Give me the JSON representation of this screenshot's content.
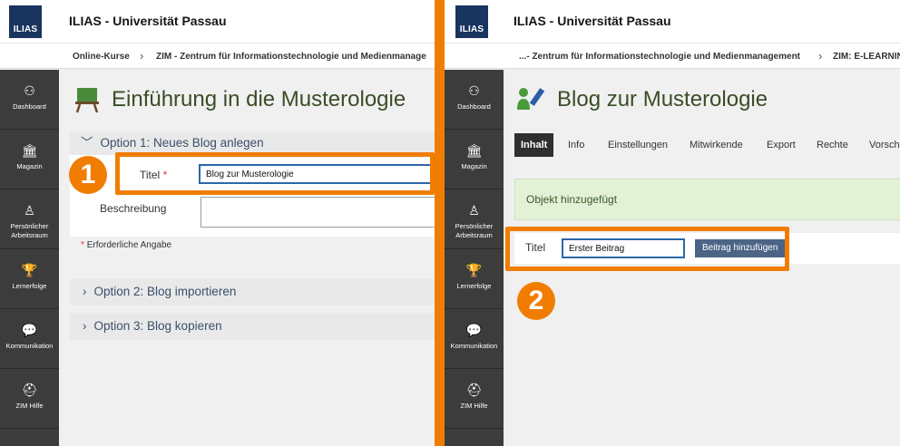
{
  "header": {
    "logo_text": "ILIAS",
    "site_title": "ILIAS - Universität Passau"
  },
  "left": {
    "breadcrumb": [
      "Online-Kurse",
      "ZIM - Zentrum für Informationstechnologie und Medienmanage"
    ],
    "page_title": "Einführung in die Musterologie",
    "option1_label": "Option 1: Neues Blog anlegen",
    "title_label": "Titel",
    "title_value": "Blog zur Musterologie",
    "description_label": "Beschreibung",
    "required_note": "Erforderliche Angabe",
    "option2_label": "Option 2: Blog importieren",
    "option3_label": "Option 3: Blog kopieren",
    "badge": "1"
  },
  "right": {
    "breadcrumb": [
      "...- Zentrum für Informationstechnologie und Medienmanagement",
      "ZIM: E-LEARNIN"
    ],
    "page_title": "Blog zur Musterologie",
    "tabs": [
      "Inhalt",
      "Info",
      "Einstellungen",
      "Mitwirkende",
      "Export",
      "Rechte",
      "Vorsch"
    ],
    "message": "Objekt hinzugefügt",
    "title_label": "Titel",
    "post_value": "Erster Beitrag",
    "add_button": "Beitrag hinzufügen",
    "badge": "2"
  },
  "mainbar": [
    {
      "label": "Dashboard",
      "icon": "dashboard-icon"
    },
    {
      "label": "Magazin",
      "icon": "building-icon"
    },
    {
      "label": "Persönlicher Arbeitsraum",
      "icon": "user-icon"
    },
    {
      "label": "Lernerfolge",
      "icon": "trophy-icon"
    },
    {
      "label": "Kommunikation",
      "icon": "chat-icon"
    },
    {
      "label": "ZIM Hilfe",
      "icon": "lifebuoy-icon"
    }
  ],
  "colors": {
    "accent": "#f07d00",
    "mainbar": "#3c3c3c",
    "logo_bg": "#19345f",
    "button": "#4c6586",
    "success": "#e3f1d7"
  }
}
